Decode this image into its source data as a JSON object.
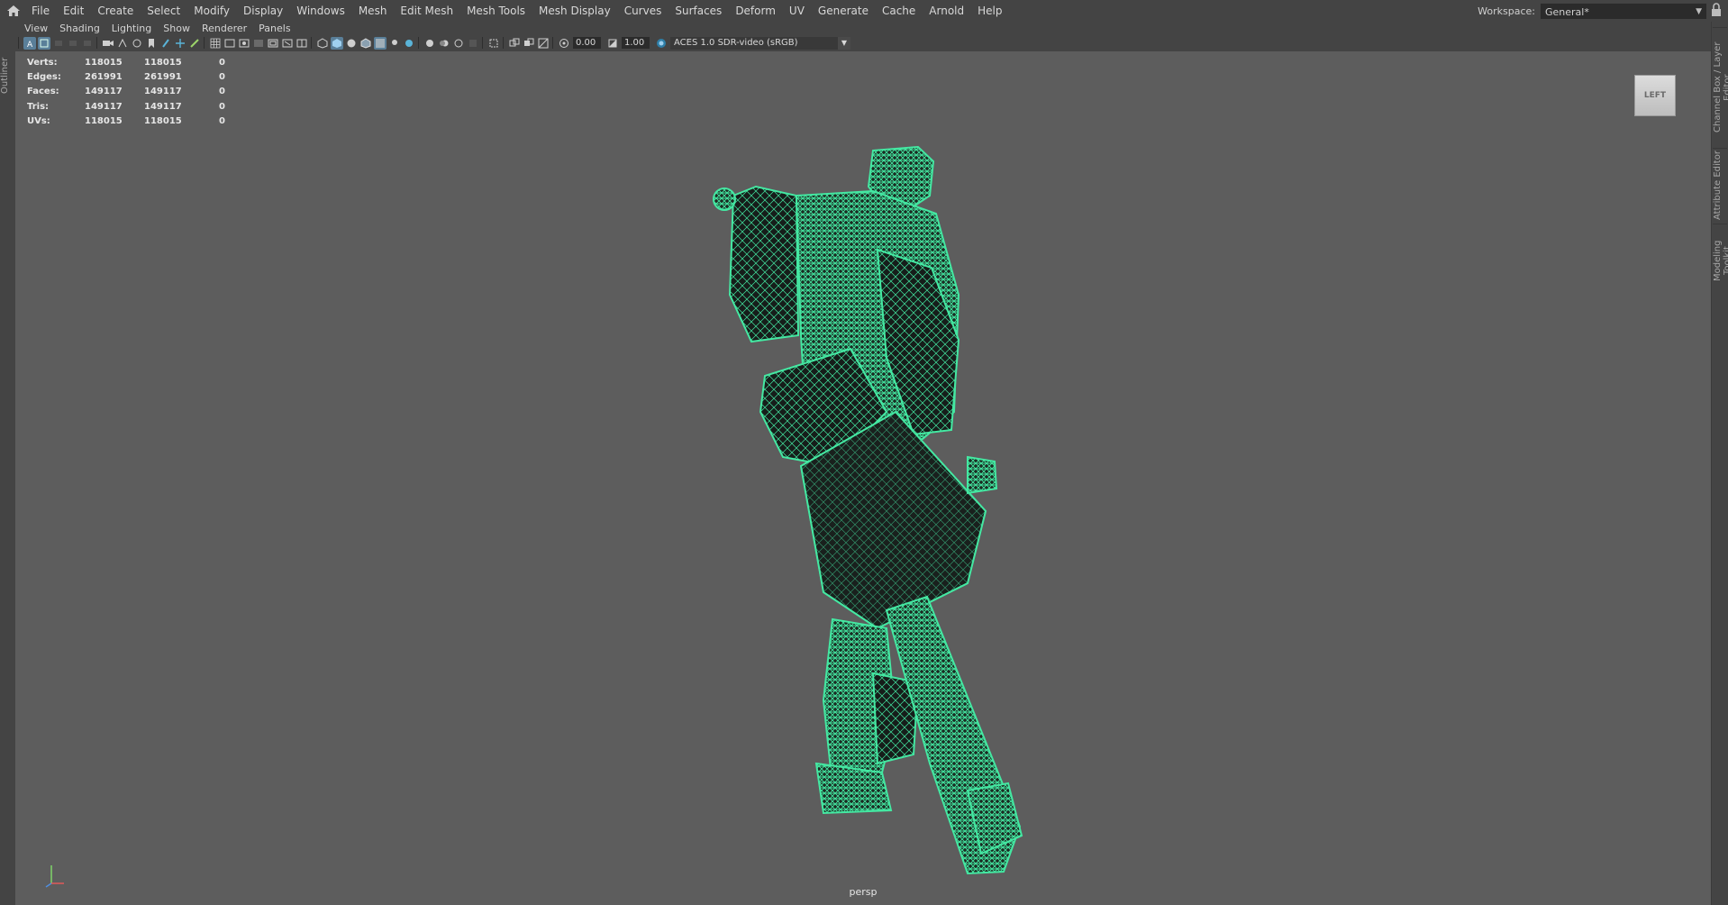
{
  "menubar": {
    "items": [
      "File",
      "Edit",
      "Create",
      "Select",
      "Modify",
      "Display",
      "Windows",
      "Mesh",
      "Edit Mesh",
      "Mesh Tools",
      "Mesh Display",
      "Curves",
      "Surfaces",
      "Deform",
      "UV",
      "Generate",
      "Cache",
      "Arnold",
      "Help"
    ],
    "workspace_label": "Workspace:",
    "workspace_value": "General*"
  },
  "left_tabs": [
    "Outliner"
  ],
  "right_tabs": [
    "Channel Box / Layer Editor",
    "Attribute Editor",
    "Modeling Toolkit"
  ],
  "panel_menu": [
    "View",
    "Shading",
    "Lighting",
    "Show",
    "Renderer",
    "Panels"
  ],
  "toolbar": {
    "exposure": "0.00",
    "gamma": "1.00",
    "color_management": "ACES 1.0 SDR-video (sRGB)"
  },
  "hud": {
    "rows": [
      {
        "label": "Verts:",
        "v1": "118015",
        "v2": "118015",
        "v3": "0"
      },
      {
        "label": "Edges:",
        "v1": "261991",
        "v2": "261991",
        "v3": "0"
      },
      {
        "label": "Faces:",
        "v1": "149117",
        "v2": "149117",
        "v3": "0"
      },
      {
        "label": "Tris:",
        "v1": "149117",
        "v2": "149117",
        "v3": "0"
      },
      {
        "label": "UVs:",
        "v1": "118015",
        "v2": "118015",
        "v3": "0"
      }
    ]
  },
  "viewcube_label": "LEFT",
  "camera_name": "persp",
  "colors": {
    "wireframe": "#44e8a2",
    "viewport_bg": "#5d5d5d",
    "ui_bg": "#444444",
    "active_button": "#5a7f99"
  }
}
